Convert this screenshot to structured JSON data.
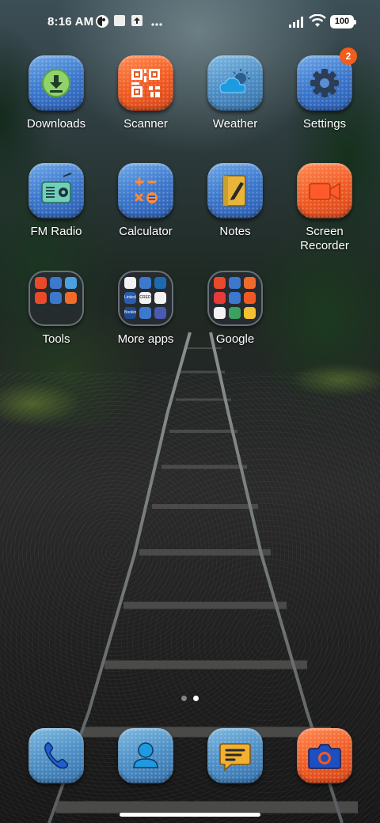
{
  "status_bar": {
    "time": "8:16 AM",
    "battery_level": "100",
    "left_icons": [
      "assistant-icon",
      "square-notification-icon",
      "upload-notification-icon",
      "more-dots-icon"
    ],
    "right_icons": [
      "signal-icon",
      "wifi-icon",
      "battery-icon"
    ]
  },
  "apps": {
    "row1": [
      {
        "label": "Downloads",
        "icon": "download-icon",
        "tile": "blue"
      },
      {
        "label": "Scanner",
        "icon": "qr-code-icon",
        "tile": "orange"
      },
      {
        "label": "Weather",
        "icon": "cloud-sun-icon",
        "tile": "blue"
      },
      {
        "label": "Settings",
        "icon": "gear-icon",
        "tile": "blue",
        "badge": "2"
      }
    ],
    "row2": [
      {
        "label": "FM Radio",
        "icon": "radio-icon",
        "tile": "blue"
      },
      {
        "label": "Calculator",
        "icon": "calculator-icon",
        "tile": "blue"
      },
      {
        "label": "Notes",
        "icon": "notepad-icon",
        "tile": "blue"
      },
      {
        "label": "Screen Recorder",
        "icon": "video-camera-icon",
        "tile": "orange"
      }
    ],
    "row3": [
      {
        "label": "Tools",
        "icon": "folder-icon",
        "tile": "folder"
      },
      {
        "label": "More apps",
        "icon": "folder-icon",
        "tile": "folder",
        "folder_texts": [
          "LinkedIn",
          "CRED",
          "Booking"
        ]
      },
      {
        "label": "Google",
        "icon": "folder-icon",
        "tile": "folder"
      }
    ]
  },
  "dock": [
    {
      "name": "phone",
      "icon": "phone-icon"
    },
    {
      "name": "contacts",
      "icon": "person-icon"
    },
    {
      "name": "messages",
      "icon": "chat-bubble-icon"
    },
    {
      "name": "camera",
      "icon": "camera-icon"
    }
  ],
  "page_indicator": {
    "pages": 2,
    "current": 2
  },
  "colors": {
    "accent_orange": "#f05a22",
    "accent_blue": "#3c78cc",
    "badge": "#f25c1d"
  }
}
